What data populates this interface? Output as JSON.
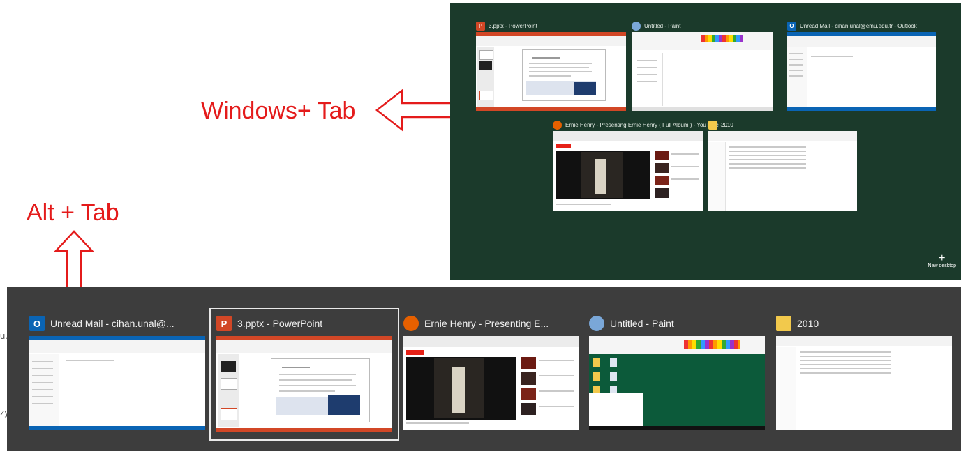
{
  "annotations": {
    "windows_tab": "Windows+ Tab",
    "alt_tab": "Alt + Tab"
  },
  "task_view": {
    "windows": [
      {
        "title": "3.pptx - PowerPoint",
        "icon": "powerpoint-icon"
      },
      {
        "title": "Untitled - Paint",
        "icon": "paint-icon"
      },
      {
        "title": "Unread Mail - cihan.unal@emu.edu.tr - Outlook",
        "icon": "outlook-icon"
      },
      {
        "title": "Ernie Henry - Presenting Ernie Henry ( Full Album ) - YouTube -...",
        "icon": "firefox-icon"
      },
      {
        "title": "2010",
        "icon": "folder-icon"
      }
    ],
    "new_desktop": "New desktop",
    "new_desktop_plus": "+"
  },
  "alt_tab": {
    "items": [
      {
        "title": "Unread Mail - cihan.unal@...",
        "icon": "outlook-icon"
      },
      {
        "title": "3.pptx - PowerPoint",
        "icon": "powerpoint-icon",
        "selected": true
      },
      {
        "title": "Ernie Henry - Presenting E...",
        "icon": "firefox-icon"
      },
      {
        "title": "Untitled - Paint",
        "icon": "paint-icon"
      },
      {
        "title": "2010",
        "icon": "folder-icon"
      }
    ]
  },
  "background_fragments": {
    "fragment_1": "u.edu",
    "fragment_2": "zy"
  },
  "icon_letters": {
    "outlook": "O",
    "powerpoint": "P"
  },
  "colors": {
    "annotation_red": "#e41b1b",
    "taskview_bg": "#1b3a2b",
    "alttab_bg": "#3d3d3d",
    "powerpoint": "#d24726",
    "outlook": "#0a64b4",
    "firefox": "#e66000",
    "folder": "#f2c94c",
    "paint_canvas": "#0c5a3a"
  }
}
